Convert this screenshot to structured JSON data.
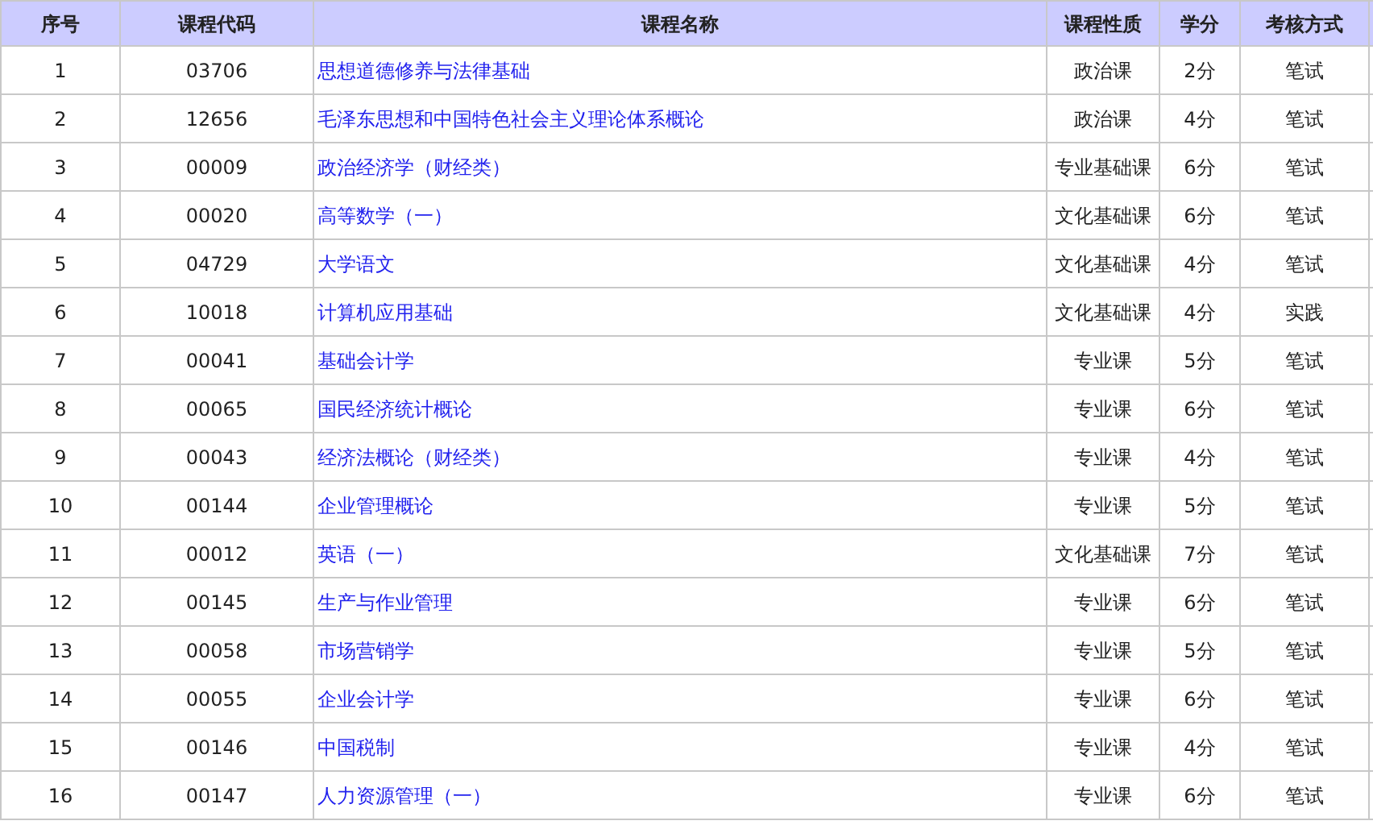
{
  "table": {
    "columns": [
      "序号",
      "课程代码",
      "课程名称",
      "课程性质",
      "学分",
      "考核方式"
    ],
    "rows": [
      {
        "no": "1",
        "code": "03706",
        "name": "思想道德修养与法律基础",
        "type": "政治课",
        "credits": "2分",
        "exam": "笔试"
      },
      {
        "no": "2",
        "code": "12656",
        "name": "毛泽东思想和中国特色社会主义理论体系概论",
        "type": "政治课",
        "credits": "4分",
        "exam": "笔试"
      },
      {
        "no": "3",
        "code": "00009",
        "name": "政治经济学（财经类）",
        "type": "专业基础课",
        "credits": "6分",
        "exam": "笔试"
      },
      {
        "no": "4",
        "code": "00020",
        "name": "高等数学（一）",
        "type": "文化基础课",
        "credits": "6分",
        "exam": "笔试"
      },
      {
        "no": "5",
        "code": "04729",
        "name": "大学语文",
        "type": "文化基础课",
        "credits": "4分",
        "exam": "笔试"
      },
      {
        "no": "6",
        "code": "10018",
        "name": "计算机应用基础",
        "type": "文化基础课",
        "credits": "4分",
        "exam": "实践"
      },
      {
        "no": "7",
        "code": "00041",
        "name": "基础会计学",
        "type": "专业课",
        "credits": "5分",
        "exam": "笔试"
      },
      {
        "no": "8",
        "code": "00065",
        "name": "国民经济统计概论",
        "type": "专业课",
        "credits": "6分",
        "exam": "笔试"
      },
      {
        "no": "9",
        "code": "00043",
        "name": "经济法概论（财经类）",
        "type": "专业课",
        "credits": "4分",
        "exam": "笔试"
      },
      {
        "no": "10",
        "code": "00144",
        "name": "企业管理概论",
        "type": "专业课",
        "credits": "5分",
        "exam": "笔试"
      },
      {
        "no": "11",
        "code": "00012",
        "name": "英语（一）",
        "type": "文化基础课",
        "credits": "7分",
        "exam": "笔试"
      },
      {
        "no": "12",
        "code": "00145",
        "name": "生产与作业管理",
        "type": "专业课",
        "credits": "6分",
        "exam": "笔试"
      },
      {
        "no": "13",
        "code": "00058",
        "name": "市场营销学",
        "type": "专业课",
        "credits": "5分",
        "exam": "笔试"
      },
      {
        "no": "14",
        "code": "00055",
        "name": "企业会计学",
        "type": "专业课",
        "credits": "6分",
        "exam": "笔试"
      },
      {
        "no": "15",
        "code": "00146",
        "name": "中国税制",
        "type": "专业课",
        "credits": "4分",
        "exam": "笔试"
      },
      {
        "no": "16",
        "code": "00147",
        "name": "人力资源管理（一）",
        "type": "专业课",
        "credits": "6分",
        "exam": "笔试"
      }
    ]
  }
}
